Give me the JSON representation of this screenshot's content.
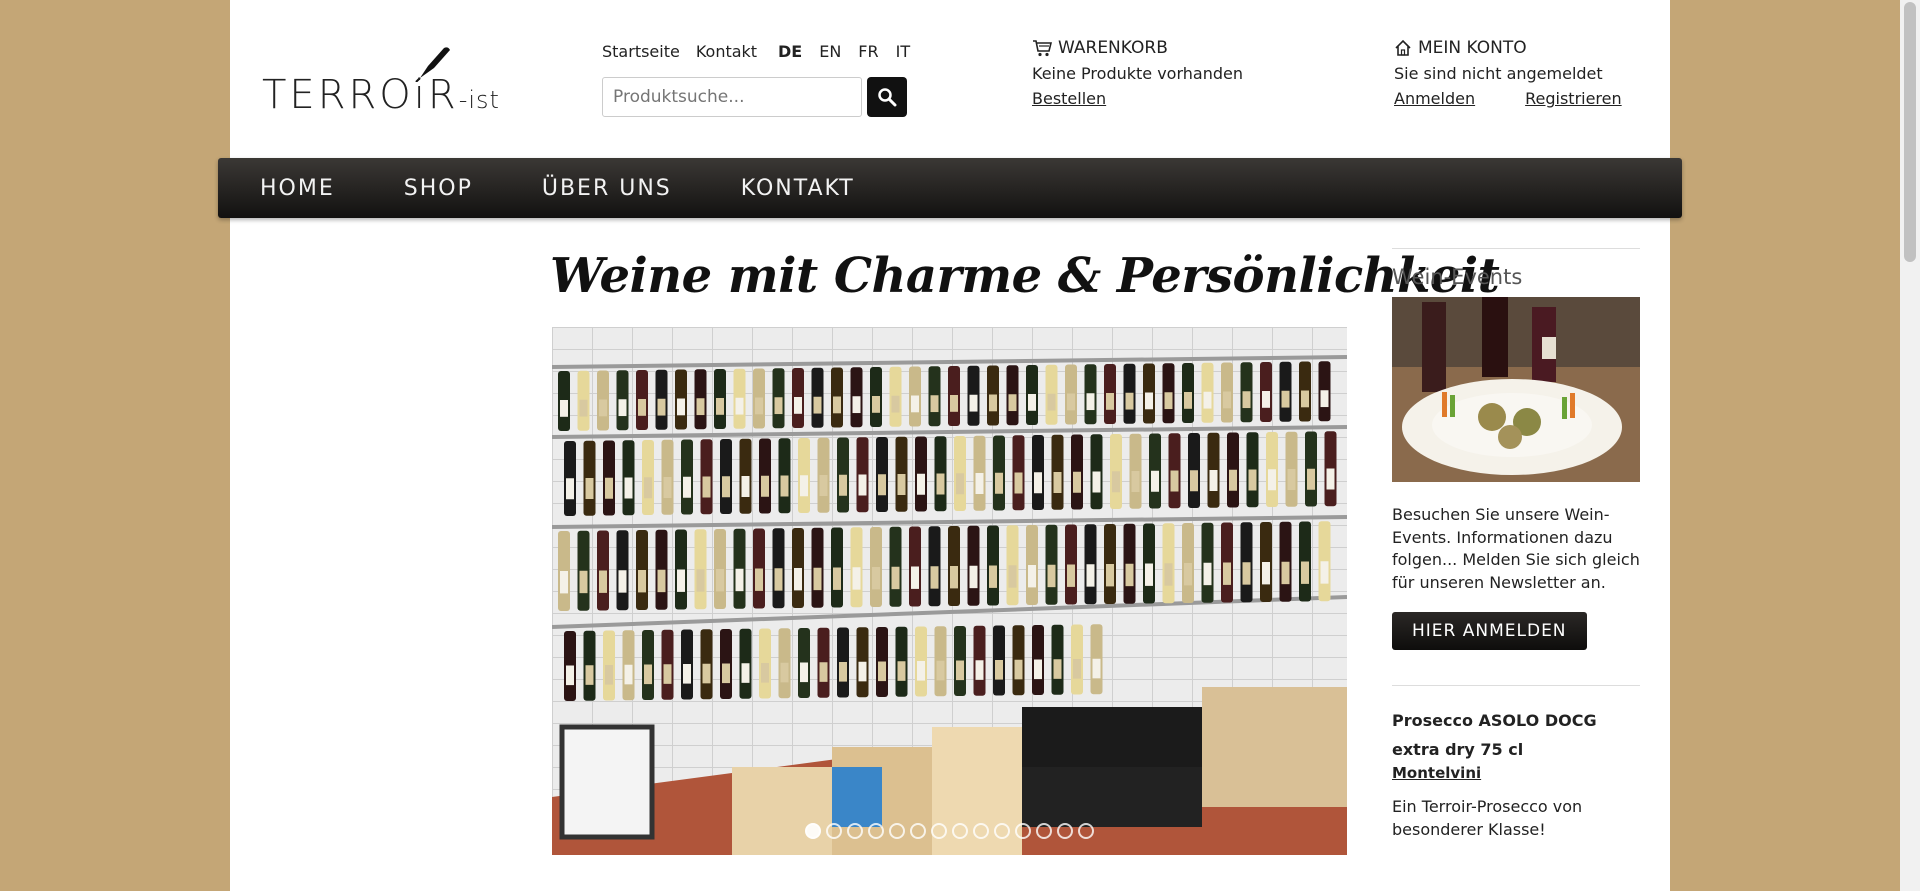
{
  "header": {
    "logo_text": "TERROiR",
    "logo_suffix": "-ist",
    "top_links": [
      "Startseite",
      "Kontakt"
    ],
    "languages": [
      "DE",
      "EN",
      "FR",
      "IT"
    ],
    "active_language": "DE",
    "search_placeholder": "Produktsuche...",
    "cart": {
      "title": "WARENKORB",
      "status": "Keine Produkte vorhanden",
      "link": "Bestellen"
    },
    "account": {
      "title": "MEIN KONTO",
      "status": "Sie sind nicht angemeldet",
      "login": "Anmelden",
      "register": "Registrieren"
    }
  },
  "nav": [
    "HOME",
    "SHOP",
    "ÜBER UNS",
    "KONTAKT"
  ],
  "main": {
    "headline": "Weine mit Charme & Persönlichkeit",
    "slider": {
      "slide_count": 14,
      "active_index": 0
    }
  },
  "sidebar": {
    "events_title": "Wein-Events",
    "events_text": "Besuchen Sie unsere Wein-Events. Informationen dazu folgen... Melden Sie sich gleich für unseren Newsletter an.",
    "events_button": "HIER ANMELDEN",
    "product_title": "Prosecco ASOLO DOCG extra dry 75 cl",
    "producer": "Montelvini",
    "product_text": "Ein Terroir-Prosecco von besonderer Klasse!"
  },
  "colors": {
    "background": "#c4a676",
    "nav": "#1a1918",
    "button": "#111111"
  }
}
